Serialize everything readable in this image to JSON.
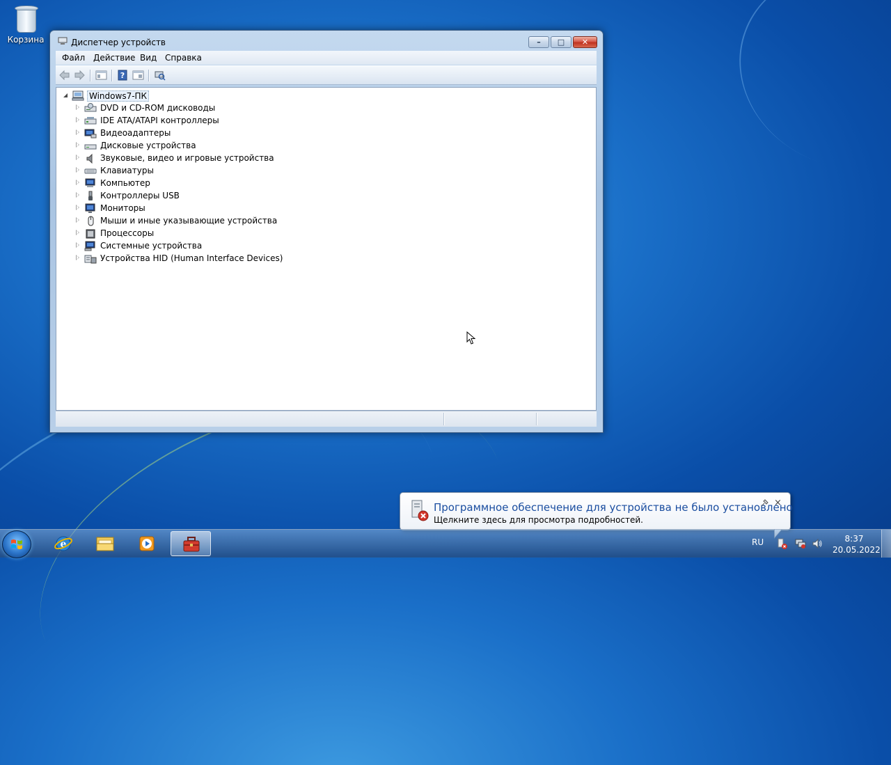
{
  "desktop": {
    "recycle_bin_label": "Корзина"
  },
  "window": {
    "title": "Диспетчер устройств",
    "menu": [
      "Файл",
      "Действие",
      "Вид",
      "Справка"
    ]
  },
  "tree": {
    "root": "Windows7-ПК",
    "nodes": [
      {
        "label": "DVD и CD-ROM дисководы",
        "icon": "dvd-drive-icon"
      },
      {
        "label": "IDE ATA/ATAPI контроллеры",
        "icon": "ide-controller-icon"
      },
      {
        "label": "Видеоадаптеры",
        "icon": "display-adapter-icon"
      },
      {
        "label": "Дисковые устройства",
        "icon": "disk-drive-icon"
      },
      {
        "label": "Звуковые, видео и игровые устройства",
        "icon": "speaker-icon"
      },
      {
        "label": "Клавиатуры",
        "icon": "keyboard-icon"
      },
      {
        "label": "Компьютер",
        "icon": "computer-icon"
      },
      {
        "label": "Контроллеры USB",
        "icon": "usb-icon"
      },
      {
        "label": "Мониторы",
        "icon": "monitor-icon"
      },
      {
        "label": "Мыши и иные указывающие устройства",
        "icon": "mouse-icon"
      },
      {
        "label": "Процессоры",
        "icon": "processor-icon"
      },
      {
        "label": "Системные устройства",
        "icon": "system-device-icon"
      },
      {
        "label": "Устройства HID (Human Interface Devices)",
        "icon": "hid-icon"
      }
    ]
  },
  "notification": {
    "title": "Программное обеспечение для устройства не было установлено",
    "text": "Щелкните здесь для просмотра подробностей.",
    "close": "×"
  },
  "taskbar": {
    "language": "RU",
    "time": "8:37",
    "date": "20.05.2022"
  },
  "colors": {
    "notification_title": "#1b4ea0",
    "close_button": "#c0321f",
    "desktop": "#1a6fc8"
  }
}
